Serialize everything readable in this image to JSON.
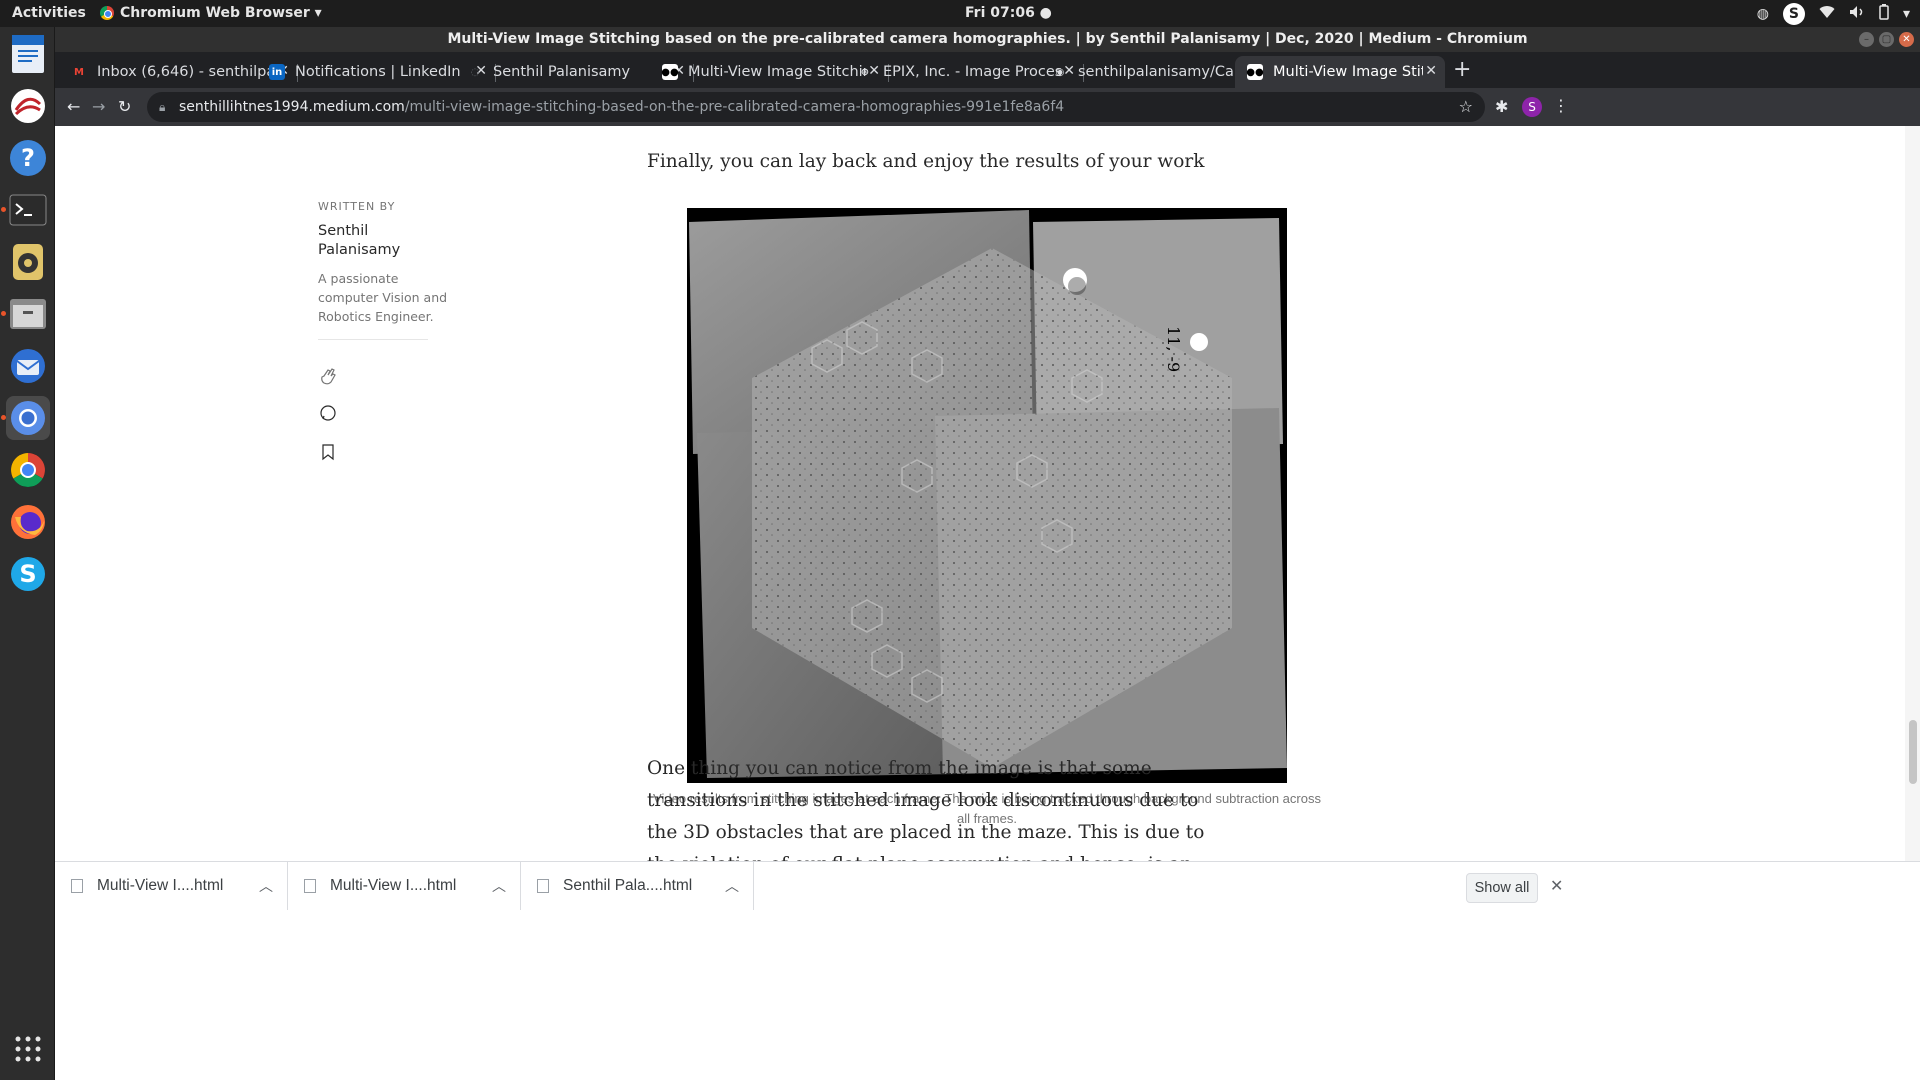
{
  "topbar": {
    "activities": "Activities",
    "app_menu": "Chromium Web Browser ▾",
    "clock": "Fri 07:06 ●",
    "tray_user_initial": "S"
  },
  "window": {
    "title": "Multi-View Image Stitching based on the pre-calibrated camera homographies. | by Senthil Palanisamy | Dec, 2020 | Medium - Chromium"
  },
  "tabs": [
    {
      "label": "Inbox (6,646) - senthilpala",
      "icon": "gmail-icon",
      "active": false
    },
    {
      "label": "Notifications | LinkedIn",
      "icon": "linkedin-icon",
      "active": false
    },
    {
      "label": "Senthil Palanisamy",
      "icon": "globe-icon",
      "active": false
    },
    {
      "label": "Multi-View Image Stitchin",
      "icon": "medium-icon",
      "active": false
    },
    {
      "label": "EPIX, Inc. - Image Processi",
      "icon": "epix-icon",
      "active": false
    },
    {
      "label": "senthilpalanisamy/Camer",
      "icon": "github-icon",
      "active": false
    },
    {
      "label": "Multi-View Image Stitchin",
      "icon": "medium-icon",
      "active": true
    }
  ],
  "address": {
    "host": "senthillihtnes1994.medium.com",
    "path": "/multi-view-image-stitching-based-on-the-pre-calibrated-camera-homographies-991e1fe8a6f4"
  },
  "profile_initial": "S",
  "article": {
    "para_final": "Finally, you can lay back and enjoy the results of your work",
    "figure_overlay": "11, -9",
    "caption": "Video results from stitching images at each frame. The mice is being tracked through background subtraction across all frames.",
    "para_one": "One thing you can notice from the image is that some transitions in the stitched image look discontinuous due to the 3D obstacles that are placed in the maze. This is due to the violation of our flat plane assumption and hence, is an expected result. To reduce this effect, the camera has to placed"
  },
  "author": {
    "label": "WRITTEN BY",
    "name": "Senthil Palanisamy",
    "bio": "A passionate computer Vision and Robotics Engineer."
  },
  "downloads": [
    {
      "name": "Multi-View I....html"
    },
    {
      "name": "Multi-View I....html"
    },
    {
      "name": "Senthil Pala....html"
    }
  ],
  "show_all": "Show all"
}
